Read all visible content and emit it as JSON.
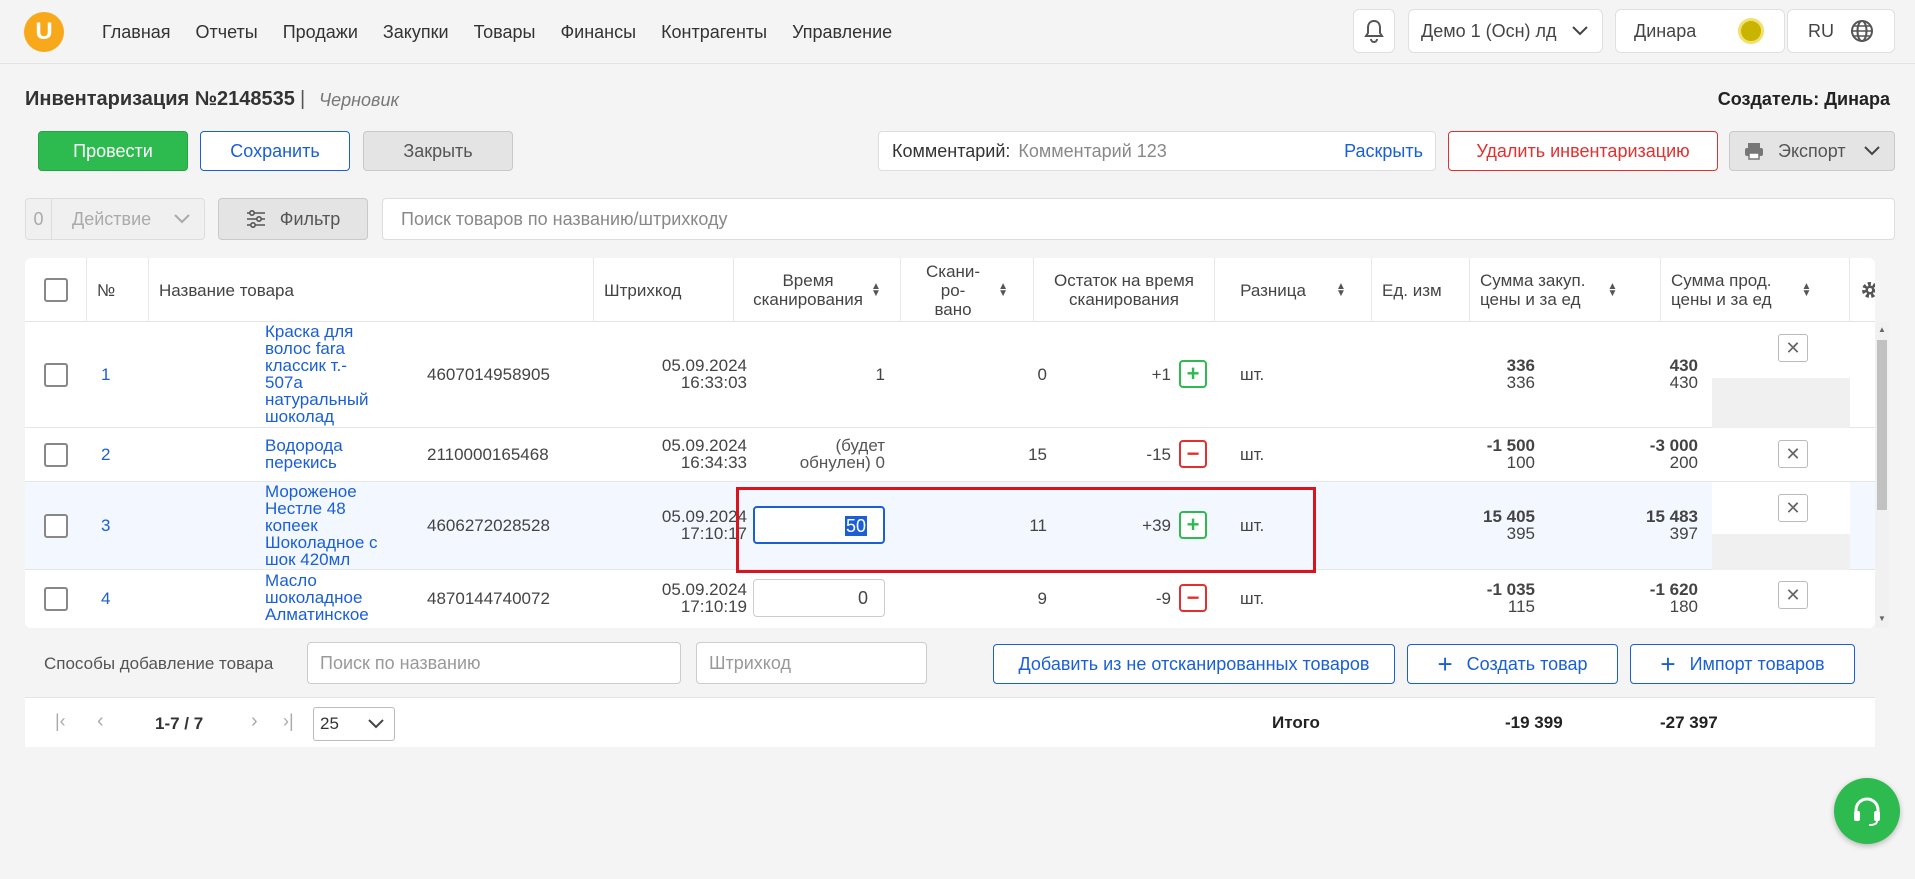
{
  "nav": {
    "logo": "U",
    "items": [
      "Главная",
      "Отчеты",
      "Продажи",
      "Закупки",
      "Товары",
      "Финансы",
      "Контрагенты",
      "Управление"
    ],
    "company": "Демо 1 (Осн) лд",
    "user": "Динара",
    "lang": "RU"
  },
  "header": {
    "title": "Инвентаризация №2148535",
    "separator": "|",
    "status": "Черновик",
    "creator": "Создатель: Динара"
  },
  "toolbar": {
    "conduct": "Провести",
    "save": "Сохранить",
    "close": "Закрыть",
    "comment_label": "Комментарий:",
    "comment_value": "Комментарий 123",
    "expand": "Раскрыть",
    "delete": "Удалить инвентаризацию",
    "export": "Экспорт"
  },
  "filters": {
    "selected_count": "0",
    "action": "Действие",
    "filter": "Фильтр",
    "search_placeholder": "Поиск товаров по названию/штрихкоду"
  },
  "columns": {
    "num": "№",
    "name": "Название товара",
    "barcode": "Штрихкод",
    "scan_time_1": "Время",
    "scan_time_2": "сканирования",
    "scanned_1": "Скани-",
    "scanned_2": "ро-",
    "scanned_3": "вано",
    "stock_1": "Остаток на время",
    "stock_2": "сканирования",
    "diff": "Разница",
    "unit": "Ед. изм",
    "purchase_1": "Сумма закуп.",
    "purchase_2": "цены и за ед",
    "sale_1": "Сумма прод.",
    "sale_2": "цены и за ед"
  },
  "rows": [
    {
      "num": "1",
      "name": [
        "Краска для",
        "волос fara",
        "классик т.-",
        "507а",
        "натуральный",
        "шоколад"
      ],
      "barcode": "4607014958905",
      "date": "05.09.2024",
      "time": "16:33:03",
      "scanned": "1",
      "stock": "0",
      "diff": "+1",
      "unit": "шт.",
      "purchase_total": "336",
      "purchase_unit": "336",
      "sale_total": "430",
      "sale_unit": "430"
    },
    {
      "num": "2",
      "name": [
        "Водорода",
        "перекись"
      ],
      "barcode": "2110000165468",
      "date": "05.09.2024",
      "time": "16:34:33",
      "scanned_1": "(будет",
      "scanned_2": "обнулен) 0",
      "stock": "15",
      "diff": "-15",
      "unit": "шт.",
      "purchase_total": "-1 500",
      "purchase_unit": "100",
      "sale_total": "-3 000",
      "sale_unit": "200"
    },
    {
      "num": "3",
      "name": [
        "Мороженое",
        "Нестле 48",
        "копеек",
        "Шоколадное с",
        "шок 420мл"
      ],
      "barcode": "4606272028528",
      "date": "05.09.2024",
      "time": "17:10:17",
      "scanned": "50",
      "stock": "11",
      "diff": "+39",
      "unit": "шт.",
      "purchase_total": "15 405",
      "purchase_unit": "395",
      "sale_total": "15 483",
      "sale_unit": "397"
    },
    {
      "num": "4",
      "name": [
        "Масло",
        "шоколадное",
        "Алматинское"
      ],
      "barcode": "4870144740072",
      "date": "05.09.2024",
      "time": "17:10:19",
      "scanned": "0",
      "stock": "9",
      "diff": "-9",
      "unit": "шт.",
      "purchase_total": "-1 035",
      "purchase_unit": "115",
      "sale_total": "-1 620",
      "sale_unit": "180"
    }
  ],
  "add": {
    "label": "Способы добавление товара",
    "name_placeholder": "Поиск по названию",
    "barcode_placeholder": "Штрихкод",
    "from_unscanned": "Добавить из не отсканированных товаров",
    "create": "Создать товар",
    "import": "Импорт товаров"
  },
  "pagination": {
    "range": "1-7 / 7",
    "page_size": "25",
    "total_label": "Итого",
    "total_purchase": "-19 399",
    "total_sale": "-27 397"
  },
  "colors": {
    "green": "#2dba4e",
    "blue": "#1a5fd6",
    "red": "#e23030",
    "highlight": "#d9141c"
  }
}
